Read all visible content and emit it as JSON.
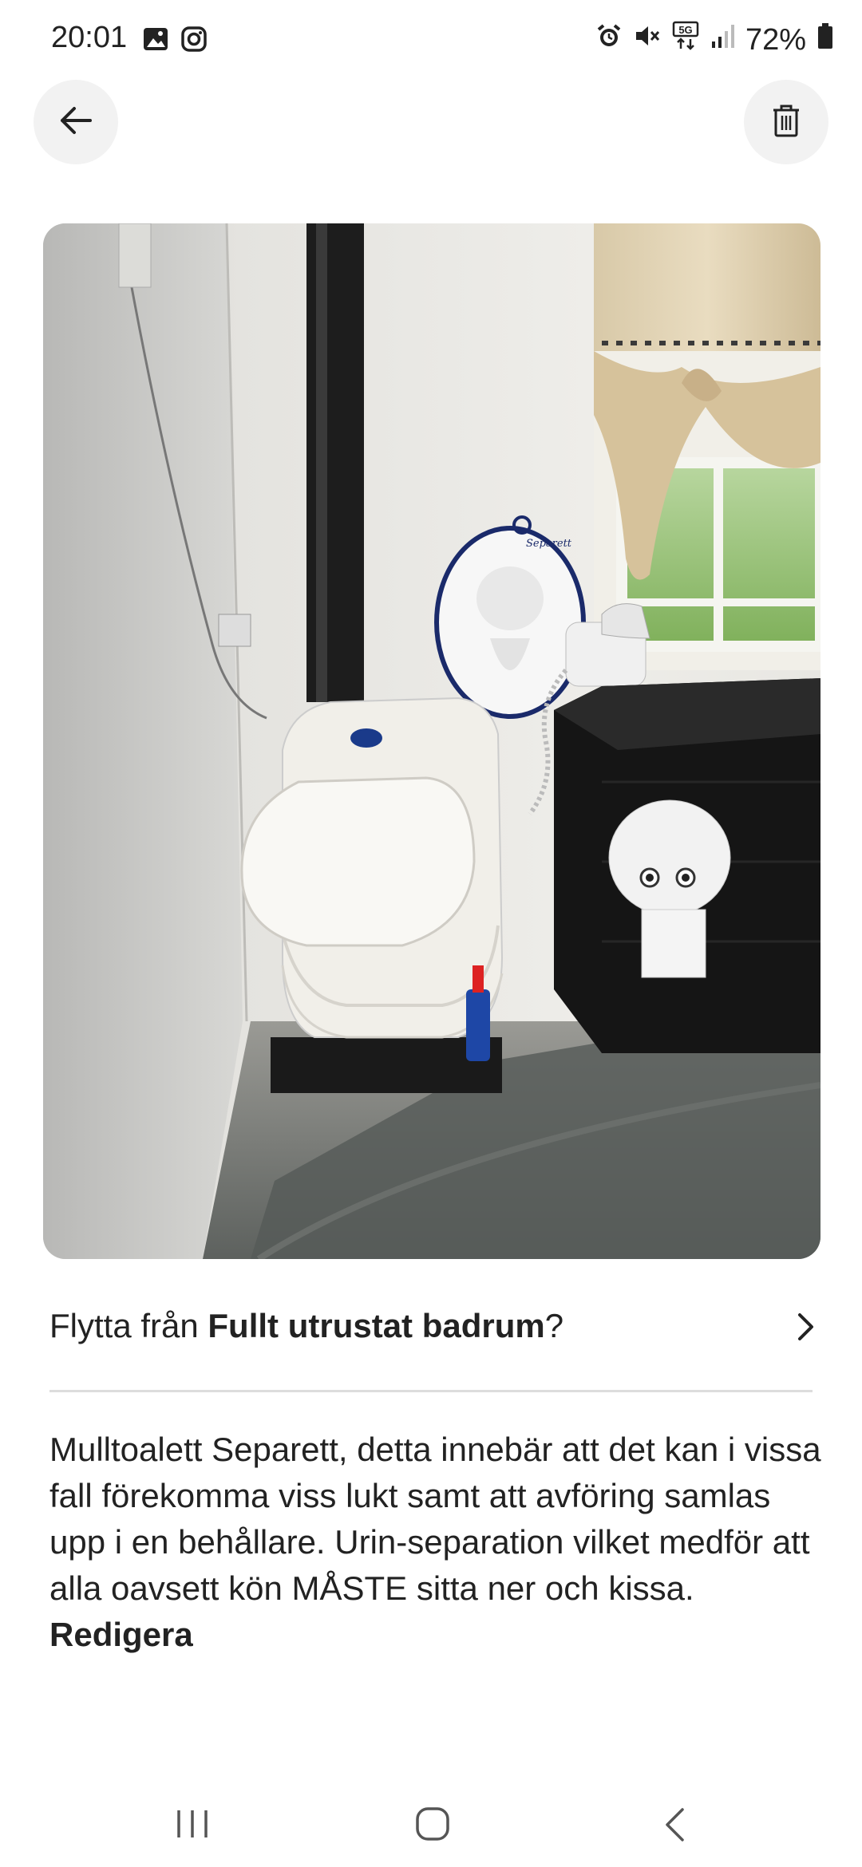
{
  "status_bar": {
    "time": "20:01",
    "battery": "72%",
    "icons": [
      "gallery-icon",
      "instagram-icon",
      "alarm-icon",
      "mute-icon",
      "5g-icon",
      "signal-icon",
      "battery-icon"
    ]
  },
  "header": {
    "back_icon": "arrow-left-icon",
    "delete_icon": "trash-icon"
  },
  "move_prompt": {
    "prefix": "Flytta från ",
    "room": "Fullt utrustat badrum",
    "suffix": "?"
  },
  "description": {
    "text": "Mulltoalett Separett, detta innebär att det kan i vissa fall förekomma viss lukt samt att avföring samlas upp i en behållare. Urin-separation vilket medför att alla oavsett kön MÅSTE sitta ner och kissa. ",
    "edit_label": "Redigera"
  },
  "photo": {
    "brand_label": "Separett"
  },
  "nav_bar": {
    "icons": [
      "recent-apps-icon",
      "home-icon",
      "back-nav-icon"
    ]
  }
}
